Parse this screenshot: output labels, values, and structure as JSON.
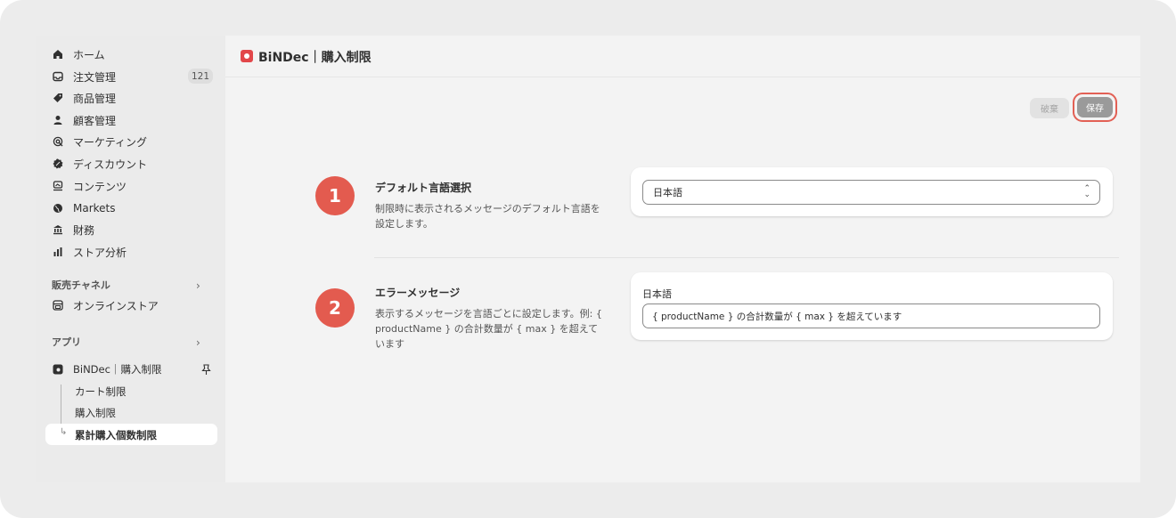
{
  "sidebar": {
    "items": [
      {
        "label": "ホーム",
        "icon": "home-icon"
      },
      {
        "label": "注文管理",
        "icon": "inbox-icon",
        "badge": "121"
      },
      {
        "label": "商品管理",
        "icon": "tag-icon"
      },
      {
        "label": "顧客管理",
        "icon": "person-icon"
      },
      {
        "label": "マーケティング",
        "icon": "target-icon"
      },
      {
        "label": "ディスカウント",
        "icon": "discount-icon"
      },
      {
        "label": "コンテンツ",
        "icon": "content-icon"
      },
      {
        "label": "Markets",
        "icon": "globe-icon"
      },
      {
        "label": "財務",
        "icon": "bank-icon"
      },
      {
        "label": "ストア分析",
        "icon": "chart-bar-icon"
      }
    ],
    "sales_channel_label": "販売チャネル",
    "online_store_label": "オンラインストア",
    "apps_label": "アプリ",
    "app_name": "BiNDec｜購入制限",
    "sub_items": [
      "カート制限",
      "購入制限",
      "累計購入個数制限"
    ]
  },
  "topbar": {
    "title": "BiNDec｜購入制限"
  },
  "actions": {
    "discard_label": "破棄",
    "save_label": "保存"
  },
  "sections": [
    {
      "step": "1",
      "title": "デフォルト言語選択",
      "description": "制限時に表示されるメッセージのデフォルト言語を設定します。",
      "select_value": "日本語"
    },
    {
      "step": "2",
      "title": "エラーメッセージ",
      "description": "表示するメッセージを言語ごとに設定します。例: { productName } の合計数量が { max } を超えています",
      "field_label": "日本語",
      "input_value": "{ productName } の合計数量が { max } を超えています"
    }
  ],
  "colors": {
    "accent": "#e35b4f",
    "logo": "#e2474a"
  }
}
